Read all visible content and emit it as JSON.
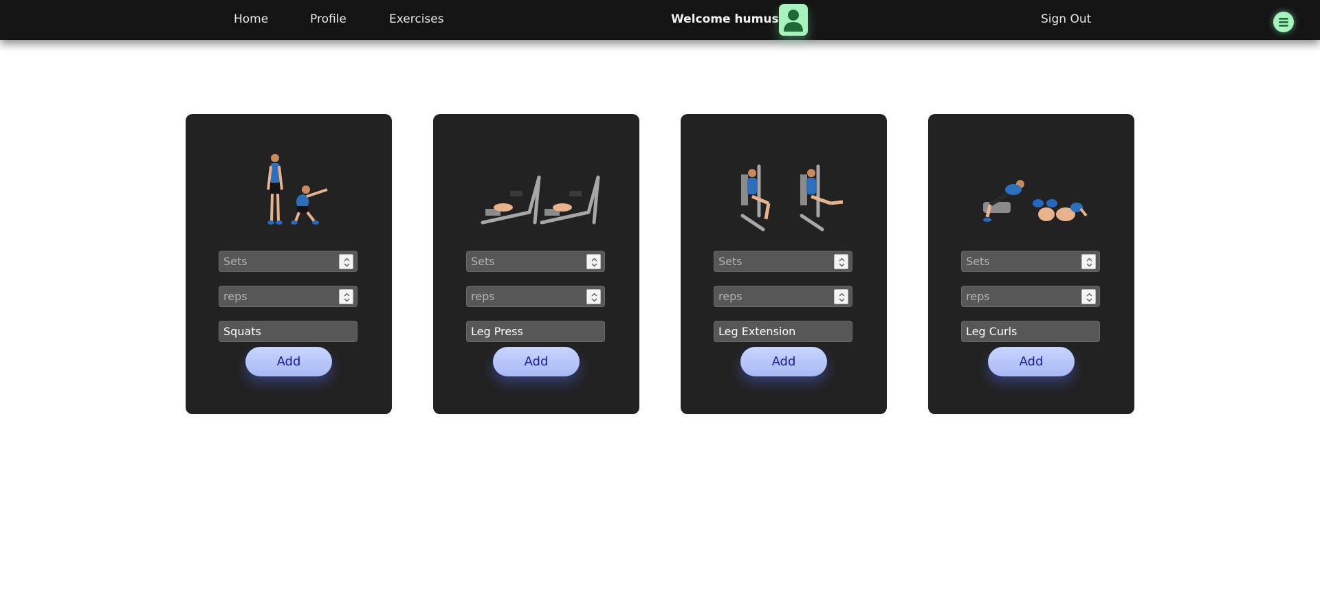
{
  "nav": {
    "home": "Home",
    "profile": "Profile",
    "exercises": "Exercises",
    "welcome": "Welcome humus",
    "sign_out": "Sign Out",
    "accent_color": "#a8f2c0"
  },
  "cards": [
    {
      "name": "Squats",
      "sets_placeholder": "Sets",
      "reps_placeholder": "reps",
      "add_label": "Add",
      "image": "squats-illustration"
    },
    {
      "name": "Leg Press",
      "sets_placeholder": "Sets",
      "reps_placeholder": "reps",
      "add_label": "Add",
      "image": "leg-press-illustration"
    },
    {
      "name": "Leg Extension",
      "sets_placeholder": "Sets",
      "reps_placeholder": "reps",
      "add_label": "Add",
      "image": "leg-extension-illustration"
    },
    {
      "name": "Leg Curls",
      "sets_placeholder": "Sets",
      "reps_placeholder": "reps",
      "add_label": "Add",
      "image": "leg-curls-illustration"
    }
  ]
}
